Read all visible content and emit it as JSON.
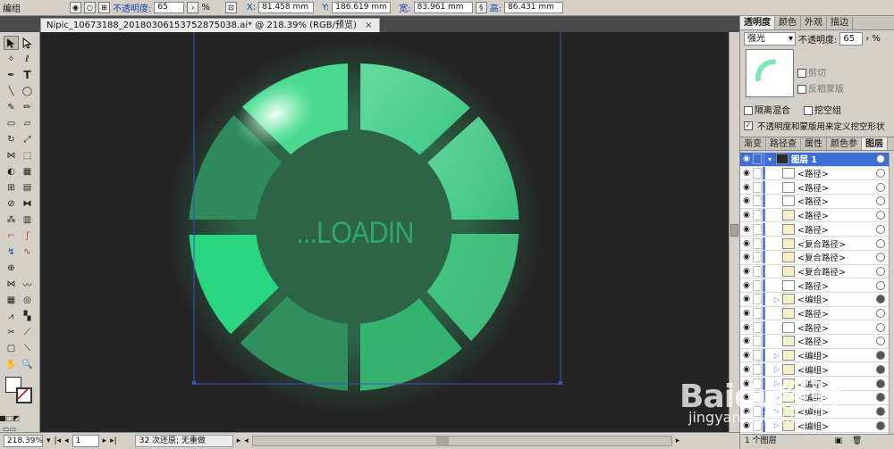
{
  "control_bar": {
    "group_label": "编组",
    "opacity_label": "不透明度:",
    "opacity_value": "65",
    "percent": "%",
    "x_label": "X:",
    "x_value": "81.458 mm",
    "y_label": "Y:",
    "y_value": "186.619 mm",
    "w_label": "宽:",
    "w_value": "83.961 mm",
    "h_label": "高:",
    "h_value": "86.431 mm"
  },
  "document": {
    "tab_title": "Nipic_10673188_20180306153752875038.ai* @ 218.39% (RGB/预览)",
    "close": "×",
    "artwork_text": "...LOADIN"
  },
  "status_bar": {
    "zoom": "218.39%",
    "page": "1",
    "message": "32 次还原; 无重做"
  },
  "transparency_panel": {
    "tabs": [
      "透明度",
      "颜色",
      "外观",
      "描边"
    ],
    "active_tab": 0,
    "blend_mode": "强光",
    "opacity_label": "不透明度:",
    "opacity_value": "65",
    "percent": "%",
    "clip_label": "剪切",
    "invert_mask_label": "反相蒙版",
    "isolate_blend_label": "隔离混合",
    "knockout_group_label": "挖空组",
    "opacity_mask_label": "不透明度和蒙版用来定义挖空形状"
  },
  "layers_panel": {
    "tabs": [
      "渐变",
      "路径查",
      "属性",
      "颜色参",
      "图层"
    ],
    "active_tab": 4,
    "layer_name": "图层 1",
    "items": [
      {
        "name": "<路径>",
        "target": "empty",
        "expander": false,
        "swatch": "#ffffff"
      },
      {
        "name": "<路径>",
        "target": "empty",
        "expander": false,
        "swatch": "#ffffff"
      },
      {
        "name": "<路径>",
        "target": "empty",
        "expander": false,
        "swatch": "#ffffff"
      },
      {
        "name": "<路径>",
        "target": "empty",
        "expander": false,
        "swatch": "#f6f0c8"
      },
      {
        "name": "<路径>",
        "target": "empty",
        "expander": false,
        "swatch": "#f6f0c8"
      },
      {
        "name": "<复合路径>",
        "target": "empty",
        "expander": false,
        "swatch": "#f6f0c8"
      },
      {
        "name": "<复合路径>",
        "target": "empty",
        "expander": false,
        "swatch": "#f6f0c8"
      },
      {
        "name": "<复合路径>",
        "target": "empty",
        "expander": false,
        "swatch": "#f6f0c8"
      },
      {
        "name": "<路径>",
        "target": "empty",
        "expander": false,
        "swatch": "#ffffff"
      },
      {
        "name": "<编组>",
        "target": "filled",
        "expander": true,
        "swatch": "#f6f0c8"
      },
      {
        "name": "<路径>",
        "target": "empty",
        "expander": false,
        "swatch": "#f6f0c8"
      },
      {
        "name": "<路径>",
        "target": "empty",
        "expander": false,
        "swatch": "#ffffff"
      },
      {
        "name": "<路径>",
        "target": "empty",
        "expander": false,
        "swatch": "#f6f0c8"
      },
      {
        "name": "<编组>",
        "target": "filled",
        "expander": true,
        "swatch": "#f6f0c8"
      },
      {
        "name": "<编组>",
        "target": "filled",
        "expander": true,
        "swatch": "#f6f0c8"
      },
      {
        "name": "<编组>",
        "target": "filled",
        "expander": true,
        "swatch": "#f6f0c8"
      },
      {
        "name": "<编组>",
        "target": "filled",
        "expander": true,
        "swatch": "#f6f0c8"
      },
      {
        "name": "<编组>",
        "target": "filled",
        "expander": true,
        "swatch": "#f6f0c8"
      },
      {
        "name": "<编组>",
        "target": "filled",
        "expander": true,
        "swatch": "#f6f0c8"
      }
    ],
    "footer": "1 个图层"
  },
  "watermark": {
    "text": "Baidu经验",
    "url": "jingyan.baidu.com"
  },
  "colors": {
    "canvas_bg": "#242424",
    "ring_green": "#2fc87a",
    "ring_dark": "#2d7a52",
    "ring_light": "#4ad78f",
    "selection": "#3b53c7",
    "text_green": "#2fa86a"
  }
}
